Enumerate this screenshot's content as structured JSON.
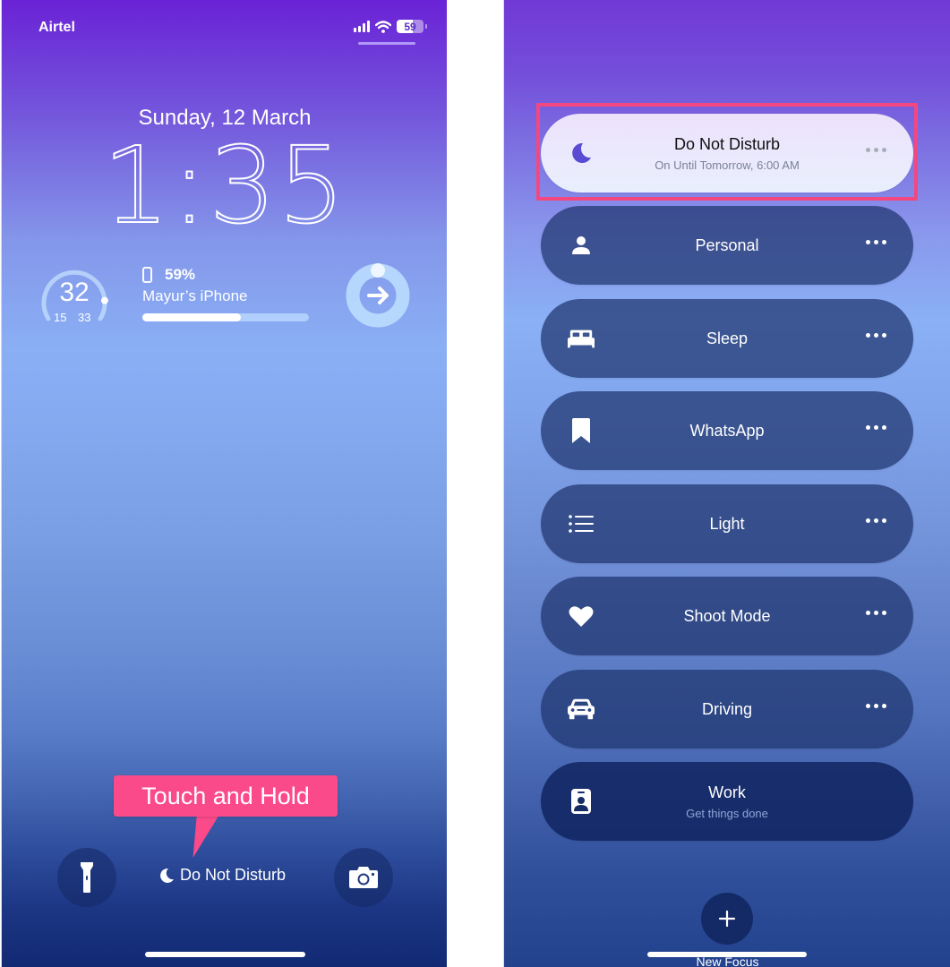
{
  "lock_screen": {
    "status_bar": {
      "carrier": "Airtel",
      "signal_bars": 4,
      "battery_level": "59",
      "battery_fraction": 0.59,
      "icons": [
        "cellular-signal-icon",
        "wifi-icon",
        "battery-icon"
      ]
    },
    "date": "Sunday, 12 March",
    "time": "1:35",
    "widgets": {
      "temperature": {
        "current": "32",
        "low": "15",
        "high": "33",
        "gauge_fraction": 0.85
      },
      "battery": {
        "percent_label": "59%",
        "device_name": "Mayur’s iPhone",
        "level_fraction": 0.59
      },
      "ring": {
        "icon": "arrow-right-icon"
      }
    },
    "callout": {
      "text": "Touch and Hold",
      "color": "#fb4a8a"
    },
    "focus_shortcut": {
      "icon": "moon-icon",
      "label": "Do Not Disturb"
    },
    "quick_actions": [
      {
        "name": "flashlight",
        "icon": "flashlight-icon"
      },
      {
        "name": "camera",
        "icon": "camera-icon"
      }
    ]
  },
  "focus_menu": {
    "highlight_color": "#f5477f",
    "items": [
      {
        "title": "Do Not Disturb",
        "subtitle": "On Until Tomorrow, 6:00 AM",
        "icon": "moon-icon",
        "active": true,
        "has_more": true
      },
      {
        "title": "Personal",
        "subtitle": "",
        "icon": "person-icon",
        "active": false,
        "has_more": true
      },
      {
        "title": "Sleep",
        "subtitle": "",
        "icon": "bed-icon",
        "active": false,
        "has_more": true
      },
      {
        "title": "WhatsApp",
        "subtitle": "",
        "icon": "bookmark-icon",
        "active": false,
        "has_more": true
      },
      {
        "title": "Light",
        "subtitle": "",
        "icon": "list-icon",
        "active": false,
        "has_more": true
      },
      {
        "title": "Shoot Mode",
        "subtitle": "",
        "icon": "heart-icon",
        "active": false,
        "has_more": true
      },
      {
        "title": "Driving",
        "subtitle": "",
        "icon": "car-icon",
        "active": false,
        "has_more": true
      },
      {
        "title": "Work",
        "subtitle": "Get things done",
        "icon": "id-badge-icon",
        "active": false,
        "has_more": false
      }
    ],
    "new_focus_label": "New Focus"
  }
}
